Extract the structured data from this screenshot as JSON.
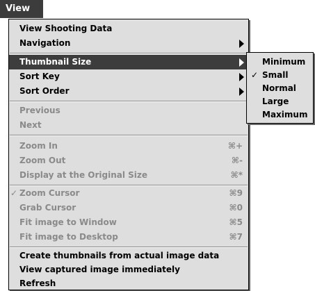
{
  "menubar": {
    "title": "View"
  },
  "main_menu": {
    "view_shooting_data": "View Shooting Data",
    "navigation": "Navigation",
    "thumbnail_size": "Thumbnail Size",
    "sort_key": "Sort Key",
    "sort_order": "Sort Order",
    "previous": "Previous",
    "next": "Next",
    "zoom_in": {
      "label": "Zoom In",
      "shortcut": "⌘+"
    },
    "zoom_out": {
      "label": "Zoom Out",
      "shortcut": "⌘-"
    },
    "display_original": {
      "label": "Display at the Original Size",
      "shortcut": "⌘*"
    },
    "zoom_cursor": {
      "label": "Zoom Cursor",
      "shortcut": "⌘9",
      "checked": true
    },
    "grab_cursor": {
      "label": "Grab Cursor",
      "shortcut": "⌘0"
    },
    "fit_window": {
      "label": "Fit image to Window",
      "shortcut": "⌘5"
    },
    "fit_desktop": {
      "label": "Fit image to Desktop",
      "shortcut": "⌘7"
    },
    "create_thumbnails": "Create thumbnails from actual image data",
    "view_captured": "View captured image immediately",
    "refresh": "Refresh"
  },
  "thumbnail_submenu": {
    "minimum": "Minimum",
    "small": "Small",
    "small_checked": true,
    "normal": "Normal",
    "large": "Large",
    "maximum": "Maximum"
  },
  "glyphs": {
    "check": "✓"
  },
  "colors": {
    "menu_bg": "#dedede",
    "highlight_bg": "#3d3d3d",
    "disabled_text": "#8a8a8a"
  }
}
